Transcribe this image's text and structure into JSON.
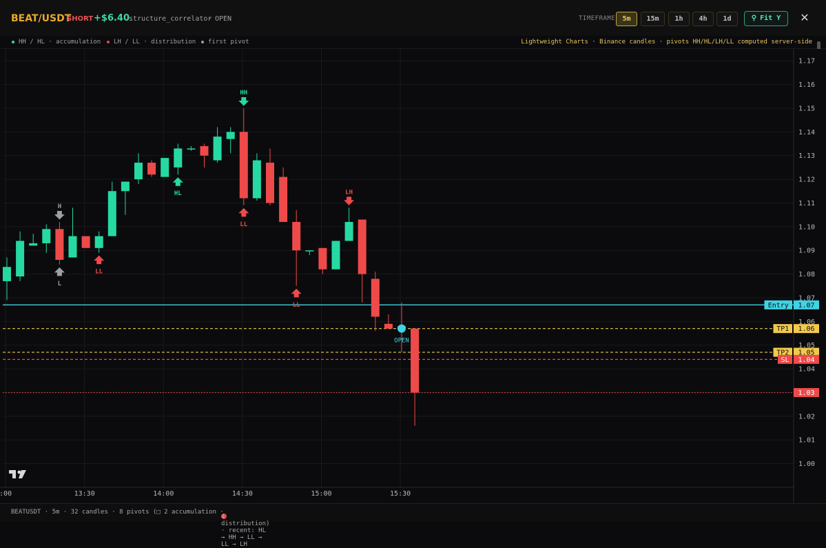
{
  "header": {
    "symbol": "BEAT/USDT",
    "side": "SHORT",
    "pnl": "+$6.40",
    "strategy": "structure_correlator",
    "dot": "·",
    "status": "OPEN",
    "timeframe_label": "TIMEFRAME",
    "timeframes": [
      "5m",
      "15m",
      "1h",
      "4h",
      "1d"
    ],
    "active_timeframe": "5m",
    "fit_label": "Fit Y",
    "close_label": "✕"
  },
  "legend": {
    "items": [
      {
        "label": "HH / HL · accumulation",
        "color": "#3fd9a0"
      },
      {
        "label": "LH / LL · distribution",
        "color": "#e5484d"
      },
      {
        "label": "first pivot",
        "color": "#9aa0a6"
      }
    ],
    "note": "Lightweight Charts · Binance candles · pivots HH/HL/LH/LL computed server-side"
  },
  "footer": {
    "left": "BEATUSDT · 5m · 32 candles · 8 pivots (□ 2 accumulation ·",
    "right": "4 distribution) · recent: HL → HH → LL → LL → LH"
  },
  "colors": {
    "up": "#26d9a3",
    "down": "#ef4a4a",
    "entry": "#3fd3e6",
    "tp": "#f2c94c",
    "sl": "#ef4a4a",
    "neutral": "#9aa0a6"
  },
  "chart_data": {
    "type": "candlestick",
    "ylim": [
      0.99,
      1.175
    ],
    "y_ticks": [
      1.0,
      1.01,
      1.02,
      1.03,
      1.04,
      1.05,
      1.06,
      1.07,
      1.08,
      1.09,
      1.1,
      1.11,
      1.12,
      1.13,
      1.14,
      1.15,
      1.16,
      1.17
    ],
    "x_ticks": [
      {
        "i": -0.1,
        "label": ":00"
      },
      {
        "i": 5.9,
        "label": "13:30"
      },
      {
        "i": 11.9,
        "label": "14:00"
      },
      {
        "i": 17.9,
        "label": "14:30"
      },
      {
        "i": 23.9,
        "label": "15:00"
      },
      {
        "i": 29.9,
        "label": "15:30"
      }
    ],
    "candles": [
      {
        "o": 1.077,
        "h": 1.087,
        "l": 1.069,
        "c": 1.083
      },
      {
        "o": 1.079,
        "h": 1.098,
        "l": 1.077,
        "c": 1.094
      },
      {
        "o": 1.092,
        "h": 1.097,
        "l": 1.092,
        "c": 1.093
      },
      {
        "o": 1.093,
        "h": 1.101,
        "l": 1.089,
        "c": 1.099
      },
      {
        "o": 1.099,
        "h": 1.102,
        "l": 1.084,
        "c": 1.086
      },
      {
        "o": 1.087,
        "h": 1.108,
        "l": 1.087,
        "c": 1.096
      },
      {
        "o": 1.096,
        "h": 1.096,
        "l": 1.091,
        "c": 1.091
      },
      {
        "o": 1.091,
        "h": 1.098,
        "l": 1.089,
        "c": 1.096
      },
      {
        "o": 1.096,
        "h": 1.119,
        "l": 1.096,
        "c": 1.115
      },
      {
        "o": 1.115,
        "h": 1.119,
        "l": 1.105,
        "c": 1.119
      },
      {
        "o": 1.12,
        "h": 1.131,
        "l": 1.118,
        "c": 1.127
      },
      {
        "o": 1.127,
        "h": 1.128,
        "l": 1.121,
        "c": 1.122
      },
      {
        "o": 1.121,
        "h": 1.129,
        "l": 1.121,
        "c": 1.129
      },
      {
        "o": 1.125,
        "h": 1.135,
        "l": 1.122,
        "c": 1.133
      },
      {
        "o": 1.133,
        "h": 1.134,
        "l": 1.132,
        "c": 1.133
      },
      {
        "o": 1.134,
        "h": 1.135,
        "l": 1.125,
        "c": 1.13
      },
      {
        "o": 1.128,
        "h": 1.142,
        "l": 1.127,
        "c": 1.138
      },
      {
        "o": 1.137,
        "h": 1.142,
        "l": 1.131,
        "c": 1.14
      },
      {
        "o": 1.14,
        "h": 1.15,
        "l": 1.109,
        "c": 1.112
      },
      {
        "o": 1.112,
        "h": 1.131,
        "l": 1.111,
        "c": 1.128
      },
      {
        "o": 1.127,
        "h": 1.133,
        "l": 1.109,
        "c": 1.11
      },
      {
        "o": 1.121,
        "h": 1.125,
        "l": 1.106,
        "c": 1.102
      },
      {
        "o": 1.102,
        "h": 1.107,
        "l": 1.075,
        "c": 1.09
      },
      {
        "o": 1.09,
        "h": 1.09,
        "l": 1.088,
        "c": 1.09
      },
      {
        "o": 1.091,
        "h": 1.091,
        "l": 1.08,
        "c": 1.082
      },
      {
        "o": 1.082,
        "h": 1.094,
        "l": 1.082,
        "c": 1.094
      },
      {
        "o": 1.094,
        "h": 1.108,
        "l": 1.094,
        "c": 1.102
      },
      {
        "o": 1.103,
        "h": 1.103,
        "l": 1.068,
        "c": 1.08
      },
      {
        "o": 1.078,
        "h": 1.081,
        "l": 1.056,
        "c": 1.062
      },
      {
        "o": 1.059,
        "h": 1.063,
        "l": 1.057,
        "c": 1.057
      },
      {
        "o": 1.058,
        "h": 1.068,
        "l": 1.047,
        "c": 1.057
      },
      {
        "o": 1.057,
        "h": 1.057,
        "l": 1.016,
        "c": 1.03
      }
    ],
    "markers": [
      {
        "i": 4,
        "label": "H",
        "dir": "down",
        "kind": "neutral",
        "price": 1.102
      },
      {
        "i": 4,
        "label": "L",
        "dir": "up",
        "kind": "neutral",
        "price": 1.084
      },
      {
        "i": 7,
        "label": "LL",
        "dir": "up",
        "kind": "down",
        "price": 1.089
      },
      {
        "i": 13,
        "label": "HL",
        "dir": "up",
        "kind": "up",
        "price": 1.122
      },
      {
        "i": 18,
        "label": "HH",
        "dir": "down",
        "kind": "up",
        "price": 1.15
      },
      {
        "i": 18,
        "label": "LL",
        "dir": "up",
        "kind": "down",
        "price": 1.109
      },
      {
        "i": 22,
        "label": "LL",
        "dir": "up",
        "kind": "down",
        "price": 1.075
      },
      {
        "i": 26,
        "label": "LH",
        "dir": "down",
        "kind": "down",
        "price": 1.108
      },
      {
        "i": 30,
        "label": "OPEN",
        "dir": "circle",
        "kind": "entry",
        "price": 1.057
      }
    ],
    "levels": [
      {
        "name": "Entry",
        "price": 1.067,
        "display": "1.07",
        "style": "solid",
        "color": "#3fd3e6"
      },
      {
        "name": "TP1",
        "price": 1.057,
        "display": "1.06",
        "style": "dashed",
        "color": "#f2c94c"
      },
      {
        "name": "TP2",
        "price": 1.047,
        "display": "1.05",
        "style": "dashed",
        "color": "#f2c94c"
      },
      {
        "name": "SL",
        "price": 1.044,
        "display": "1.04",
        "style": "dashed",
        "color": "#ef4a4a"
      },
      {
        "name": "",
        "price": 1.03,
        "display": "1.03",
        "style": "dotted",
        "color": "#ef4a4a"
      }
    ]
  }
}
